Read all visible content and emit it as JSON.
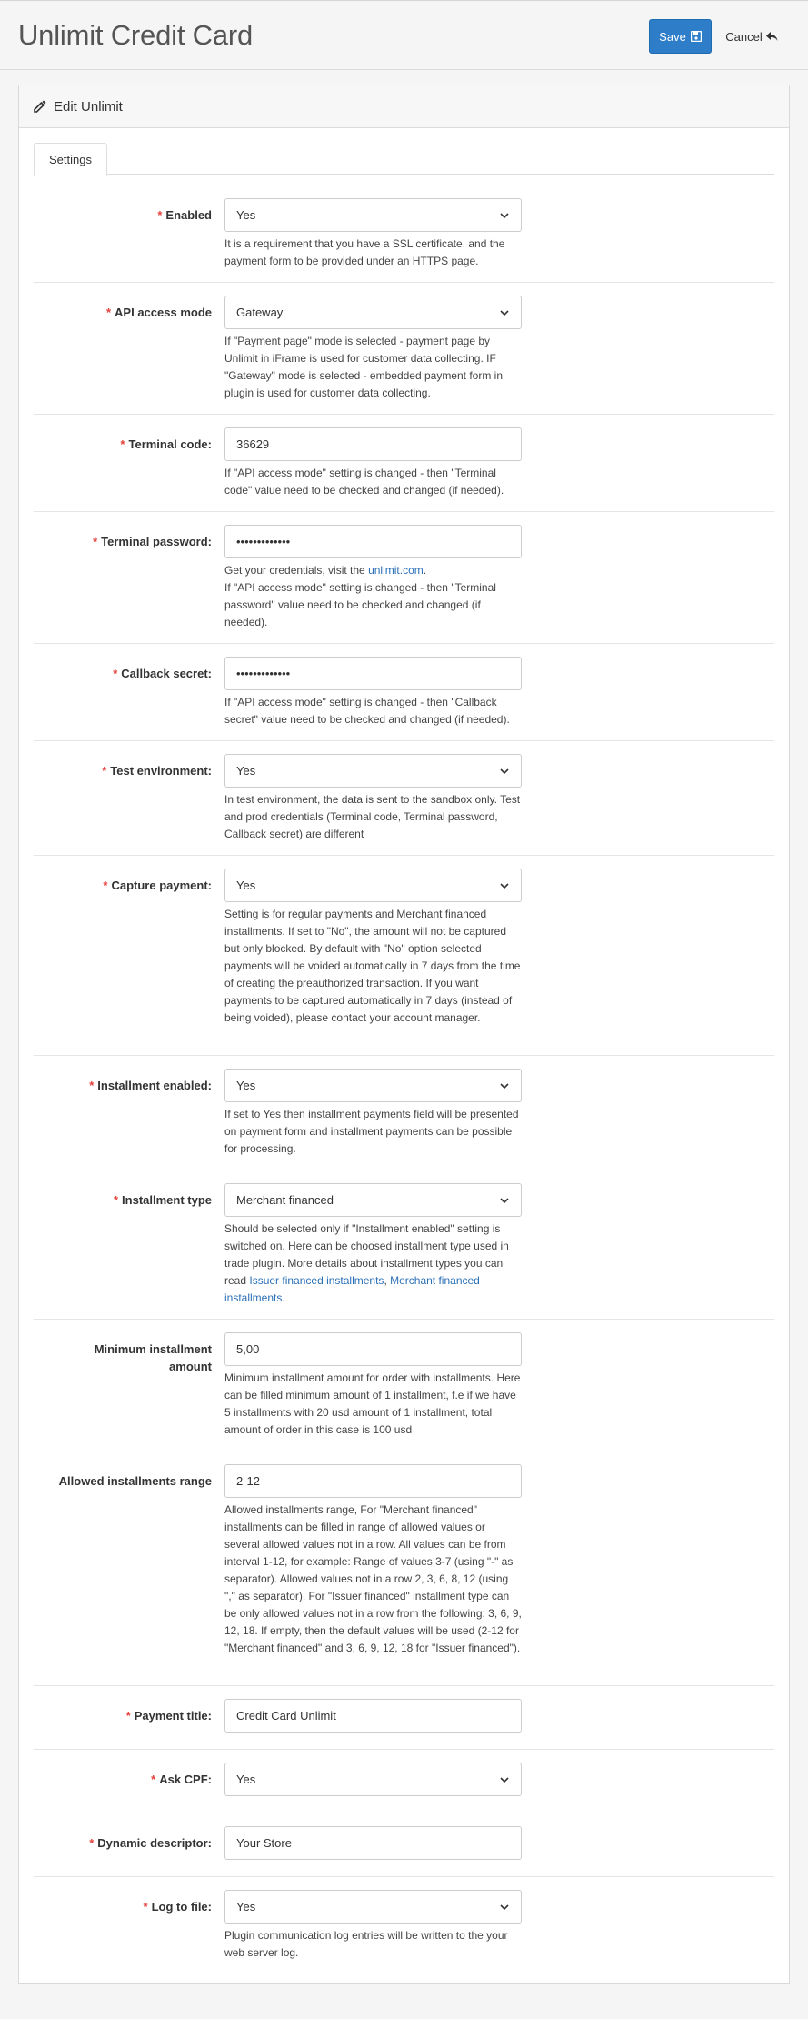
{
  "header": {
    "title": "Unlimit Credit Card",
    "save_label": "Save",
    "cancel_label": "Cancel"
  },
  "panel": {
    "heading": "Edit Unlimit",
    "tab_settings": "Settings"
  },
  "fields": {
    "enabled": {
      "label": "Enabled",
      "value": "Yes",
      "help": "It is a requirement that you have a SSL certificate, and the payment form to be provided under an HTTPS page."
    },
    "api_mode": {
      "label": "API access mode",
      "value": "Gateway",
      "help": "If \"Payment page\" mode is selected - payment page by Unlimit in iFrame is used for customer data collecting. IF \"Gateway\" mode is selected - embedded payment form in plugin is used for customer data collecting."
    },
    "terminal_code": {
      "label": "Terminal code:",
      "value": "36629",
      "help": "If \"API access mode\" setting is changed - then \"Terminal code\" value need to be checked and changed (if needed)."
    },
    "terminal_password": {
      "label": "Terminal password:",
      "value": "•••••••••••••",
      "help_prefix": "Get your credentials, visit the ",
      "help_link": "unlimit.com",
      "help_suffix": ".",
      "help_2": "If \"API access mode\" setting is changed - then \"Terminal password\" value need to be checked and changed (if needed)."
    },
    "callback_secret": {
      "label": "Callback secret:",
      "value": "•••••••••••••",
      "help": "If \"API access mode\" setting is changed - then \"Callback secret\" value need to be checked and changed (if needed)."
    },
    "test_env": {
      "label": "Test environment:",
      "value": "Yes",
      "help": "In test environment, the data is sent to the sandbox only. Test and prod credentials (Terminal code, Terminal password, Callback secret) are different"
    },
    "capture_payment": {
      "label": "Capture payment:",
      "value": "Yes",
      "help": "Setting is for regular payments and Merchant financed installments. If set to \"No\", the amount will not be captured but only blocked. By default with \"No\" option selected payments will be voided automatically in 7 days from the time of creating the preauthorized transaction. If you want payments to be captured automatically in 7 days (instead of being voided), please contact your account manager."
    },
    "installment_enabled": {
      "label": "Installment enabled:",
      "value": "Yes",
      "help": "If set to Yes then installment payments field will be presented on payment form and installment payments can be possible for processing."
    },
    "installment_type": {
      "label": "Installment type",
      "value": "Merchant financed",
      "help_prefix": "Should be selected only if \"Installment enabled\" setting is switched on. Here can be choosed installment type used in trade plugin. More details about installment types you can read ",
      "help_link_1": "Issuer financed installments",
      "help_sep": ", ",
      "help_link_2": "Merchant financed installments",
      "help_suffix": "."
    },
    "min_installment": {
      "label_line1": "Minimum installment",
      "label_line2": "amount",
      "value": "5,00",
      "help": "Minimum installment amount for order with installments. Here can be filled minimum amount of 1 installment, f.e if we have 5 installments with 20 usd amount of 1 installment, total amount of order in this case is 100 usd"
    },
    "allowed_range": {
      "label": "Allowed installments range",
      "value": "2-12",
      "help": "Allowed installments range, For \"Merchant financed\" installments can be filled in range of allowed values or several allowed values not in a row. All values can be from interval 1-12, for example: Range of values 3-7 (using \"-\" as separator). Allowed values not in a row 2, 3, 6, 8, 12 (using \",\" as separator). For \"Issuer financed\" installment type can be only allowed values not in a row from the following: 3, 6, 9, 12, 18. If empty, then the default values will be used (2-12 for \"Merchant financed\" and 3, 6, 9, 12, 18 for \"Issuer financed\")."
    },
    "payment_title": {
      "label": "Payment title:",
      "value": "Credit Card Unlimit"
    },
    "ask_cpf": {
      "label": "Ask CPF:",
      "value": "Yes"
    },
    "dynamic_descriptor": {
      "label": "Dynamic descriptor:",
      "value": "Your Store"
    },
    "log_to_file": {
      "label": "Log to file:",
      "value": "Yes",
      "help": "Plugin communication log entries will be written to the your web server log."
    }
  },
  "required_mark": "*",
  "colors": {
    "primary": "#2d7dc8",
    "required": "#e3403b",
    "link": "#2a6fb6"
  }
}
